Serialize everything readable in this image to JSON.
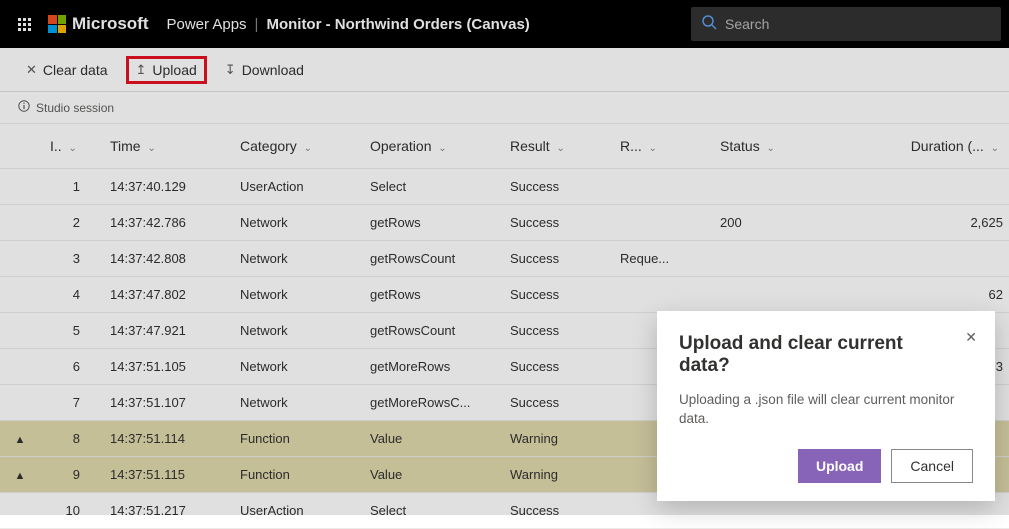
{
  "header": {
    "brand": "Microsoft",
    "app": "Power Apps",
    "context": "Monitor - Northwind Orders (Canvas)",
    "search_placeholder": "Search"
  },
  "toolbar": {
    "clear": "Clear data",
    "upload": "Upload",
    "download": "Download"
  },
  "session_label": "Studio session",
  "columns": {
    "id": "I..",
    "time": "Time",
    "category": "Category",
    "operation": "Operation",
    "result": "Result",
    "r": "R...",
    "status": "Status",
    "duration": "Duration (..."
  },
  "rows": [
    {
      "warn": false,
      "id": "1",
      "time": "14:37:40.129",
      "category": "UserAction",
      "operation": "Select",
      "result": "Success",
      "r": "",
      "status": "",
      "duration": ""
    },
    {
      "warn": false,
      "id": "2",
      "time": "14:37:42.786",
      "category": "Network",
      "operation": "getRows",
      "result": "Success",
      "r": "",
      "status": "200",
      "duration": "2,625"
    },
    {
      "warn": false,
      "id": "3",
      "time": "14:37:42.808",
      "category": "Network",
      "operation": "getRowsCount",
      "result": "Success",
      "r": "Reque...",
      "status": "",
      "duration": ""
    },
    {
      "warn": false,
      "id": "4",
      "time": "14:37:47.802",
      "category": "Network",
      "operation": "getRows",
      "result": "Success",
      "r": "",
      "status": "",
      "duration": "62"
    },
    {
      "warn": false,
      "id": "5",
      "time": "14:37:47.921",
      "category": "Network",
      "operation": "getRowsCount",
      "result": "Success",
      "r": "",
      "status": "",
      "duration": ""
    },
    {
      "warn": false,
      "id": "6",
      "time": "14:37:51.105",
      "category": "Network",
      "operation": "getMoreRows",
      "result": "Success",
      "r": "",
      "status": "",
      "duration": "93"
    },
    {
      "warn": false,
      "id": "7",
      "time": "14:37:51.107",
      "category": "Network",
      "operation": "getMoreRowsC...",
      "result": "Success",
      "r": "",
      "status": "",
      "duration": ""
    },
    {
      "warn": true,
      "id": "8",
      "time": "14:37:51.114",
      "category": "Function",
      "operation": "Value",
      "result": "Warning",
      "r": "",
      "status": "",
      "duration": ""
    },
    {
      "warn": true,
      "id": "9",
      "time": "14:37:51.115",
      "category": "Function",
      "operation": "Value",
      "result": "Warning",
      "r": "",
      "status": "",
      "duration": ""
    },
    {
      "warn": false,
      "id": "10",
      "time": "14:37:51.217",
      "category": "UserAction",
      "operation": "Select",
      "result": "Success",
      "r": "",
      "status": "",
      "duration": ""
    }
  ],
  "dialog": {
    "title": "Upload and clear current data?",
    "body": "Uploading a .json file will clear current monitor data.",
    "primary": "Upload",
    "secondary": "Cancel"
  }
}
